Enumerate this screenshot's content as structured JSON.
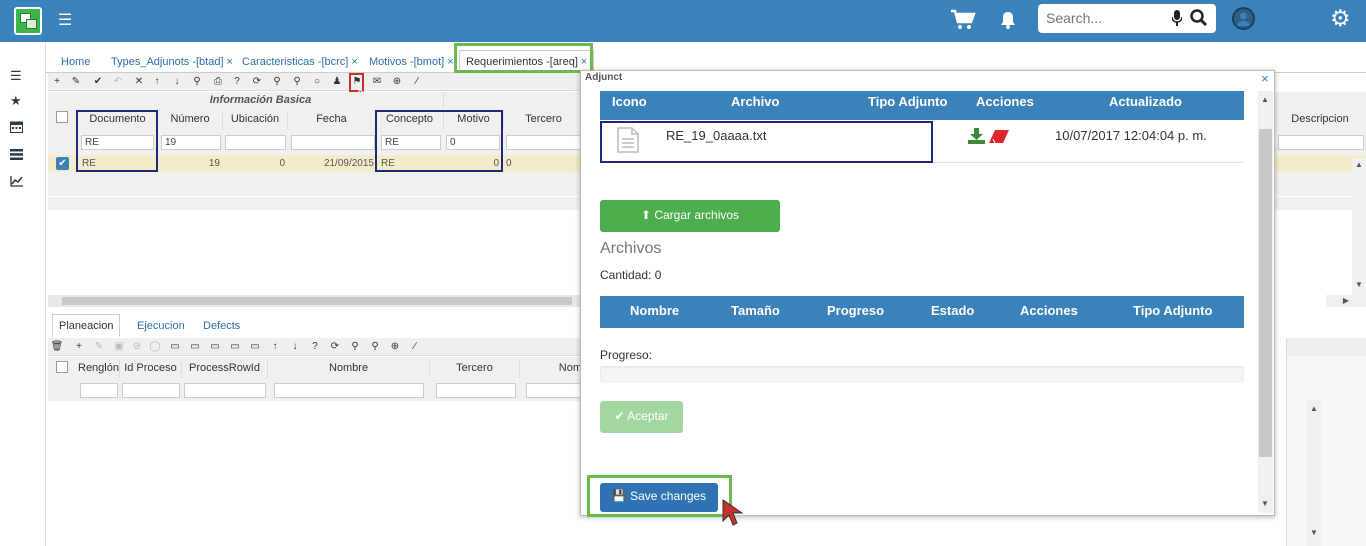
{
  "topbar": {
    "search_placeholder": "Search...",
    "icons": [
      "logo-icon",
      "menu-icon",
      "cart-icon",
      "bell-icon",
      "microphone-icon",
      "search-icon",
      "user-avatar-icon",
      "settings-gear-icon"
    ]
  },
  "sidebar": {
    "icons": [
      "menu-icon",
      "star-icon",
      "calendar-icon",
      "list-icon",
      "chart-line-icon"
    ]
  },
  "tabs": [
    {
      "label": "Home"
    },
    {
      "label": "Types_Adjunots -[btad]"
    },
    {
      "label": "Caracteristicas -[bcrc]"
    },
    {
      "label": "Motivos -[bmot]"
    },
    {
      "label": "Requerimientos -[areq]"
    }
  ],
  "tab_close": "×",
  "grid1": {
    "group_header": "Información Basica",
    "columns": [
      "Documento",
      "Número",
      "Ubicación",
      "Fecha",
      "Concepto",
      "Motivo",
      "Tercero",
      "Descripcion"
    ],
    "filters": [
      "RE",
      "19",
      "",
      "",
      "RE",
      "0",
      ""
    ],
    "row": {
      "documento": "RE",
      "numero": "19",
      "ubicacion": "0",
      "fecha": "21/09/2015",
      "concepto": "RE",
      "motivo": "0",
      "tercero": "0"
    }
  },
  "subtabs": [
    "Planeacion",
    "Ejecucion",
    "Defects"
  ],
  "grid2": {
    "columns": [
      "Renglón",
      "Id Proceso",
      "ProcessRowId",
      "Nombre",
      "Tercero",
      "Nom"
    ]
  },
  "modal": {
    "title": "Adjunct",
    "close": "×",
    "table1": {
      "headers": [
        "Icono",
        "Archivo",
        "Tipo Adjunto",
        "Acciones",
        "Actualizado"
      ],
      "row": {
        "archivo": "RE_19_0aaaa.txt",
        "actualizado": "10/07/2017 12:04:04 p. m."
      }
    },
    "upload_label": "Cargar archivos",
    "archivos_title": "Archivos",
    "cantidad": "Cantidad: 0",
    "table2": {
      "headers": [
        "Nombre",
        "Tamaño",
        "Progreso",
        "Estado",
        "Acciones",
        "Tipo Adjunto"
      ]
    },
    "progreso_label": "Progreso:",
    "progress": 0,
    "aceptar_label": "Aceptar",
    "save_label": "Save changes"
  },
  "colors": {
    "topbar": "#3a82b9",
    "accent_green": "#4cae4c",
    "table_header": "#3a82b9",
    "highlight_box": "#1c2a77",
    "callout_green": "#6cba4e",
    "callout_red": "#c9302c"
  }
}
